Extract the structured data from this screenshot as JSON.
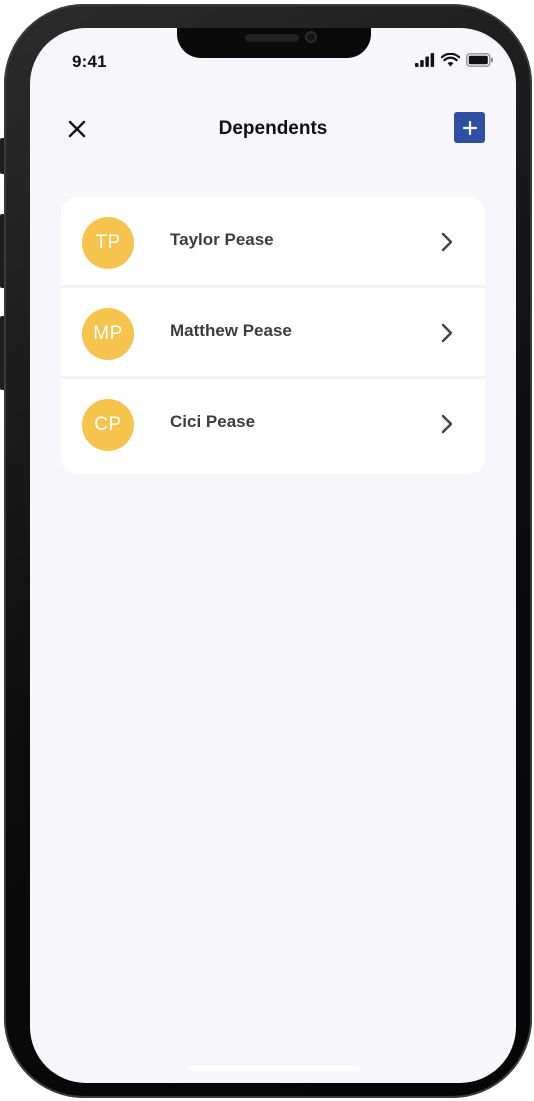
{
  "status_bar": {
    "time": "9:41",
    "signal_icon": "cellular-signal-icon",
    "wifi_icon": "wifi-icon",
    "battery_icon": "battery-icon"
  },
  "nav": {
    "title": "Dependents",
    "close_icon": "close-icon",
    "add_icon": "plus-icon"
  },
  "dependents": [
    {
      "initials": "TP",
      "name": "Taylor Pease"
    },
    {
      "initials": "MP",
      "name": "Matthew Pease"
    },
    {
      "initials": "CP",
      "name": "Cici Pease"
    }
  ],
  "colors": {
    "accent": "#2f4fa5",
    "avatar": "#f6c34c",
    "background": "#f7f7fb"
  }
}
